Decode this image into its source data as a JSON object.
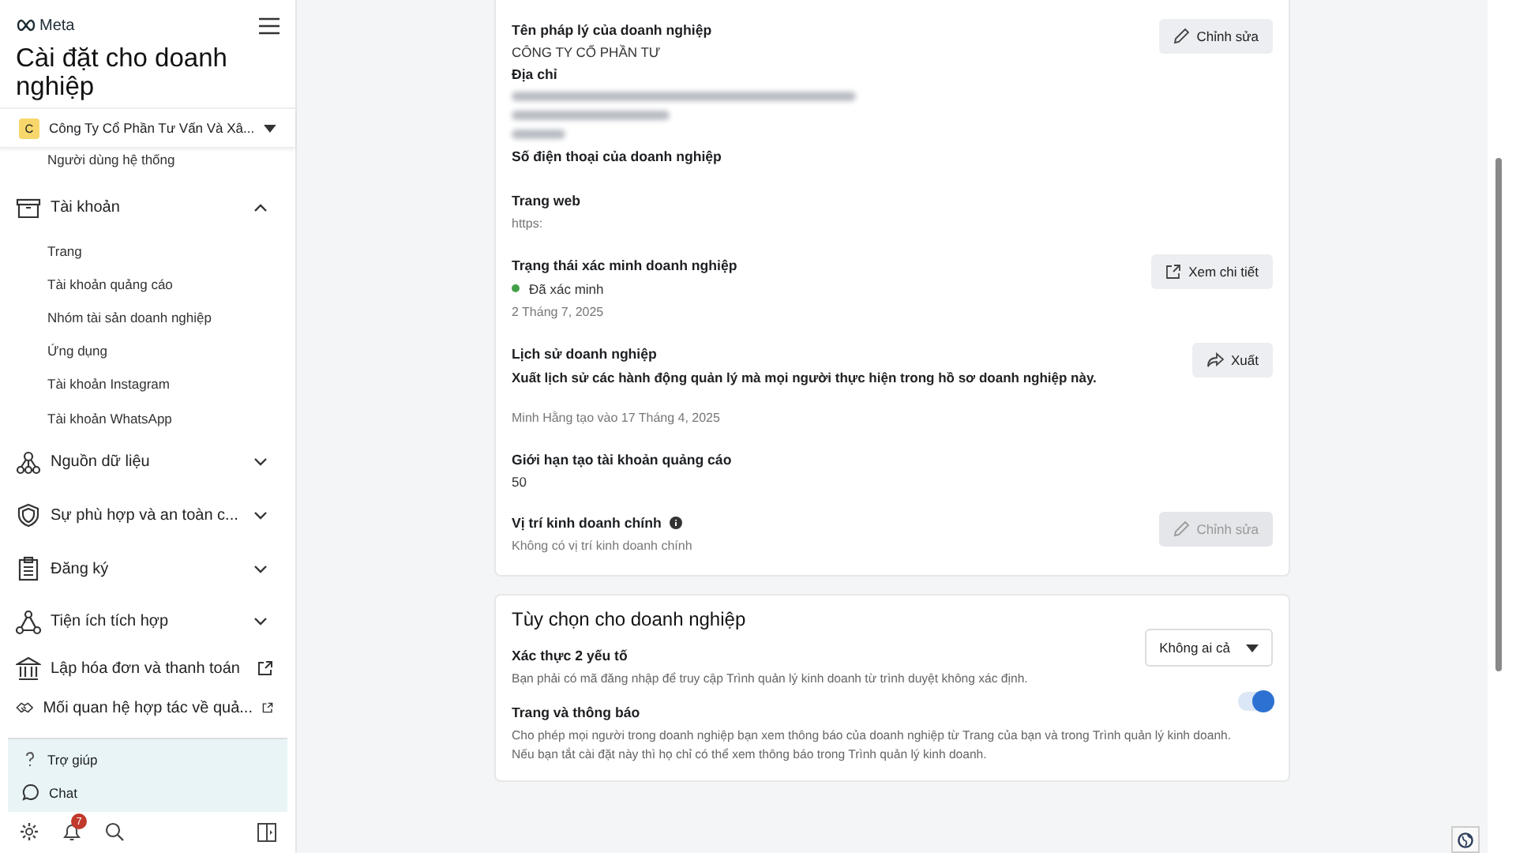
{
  "header": {
    "logo": "Meta",
    "title": "Cài đặt cho doanh nghiệp"
  },
  "business_selector": {
    "initial": "C",
    "name": "Công Ty Cổ Phần Tư Vấn Và Xâ..."
  },
  "sidebar": {
    "items": [
      {
        "kind": "item",
        "label": "Người dùng hệ thống"
      },
      {
        "kind": "group",
        "label": "Tài khoản",
        "expanded": true,
        "children": [
          {
            "label": "Trang"
          },
          {
            "label": "Tài khoản quảng cáo"
          },
          {
            "label": "Nhóm tài sản doanh nghiệp"
          },
          {
            "label": "Ứng dụng"
          },
          {
            "label": "Tài khoản Instagram"
          },
          {
            "label": "Tài khoản WhatsApp"
          }
        ]
      },
      {
        "kind": "group",
        "label": "Nguồn dữ liệu",
        "expanded": false
      },
      {
        "kind": "group",
        "label": "Sự phù hợp và an toàn c...",
        "expanded": false
      },
      {
        "kind": "group",
        "label": "Đăng ký",
        "expanded": false
      },
      {
        "kind": "group",
        "label": "Tiện ích tích hợp",
        "expanded": false
      },
      {
        "kind": "link",
        "label": "Lập hóa đơn và thanh toán"
      },
      {
        "kind": "link",
        "label": "Mối quan hệ hợp tác về quả..."
      }
    ]
  },
  "help": [
    {
      "kind": "help",
      "label": "Trợ giúp"
    },
    {
      "kind": "chat",
      "label": "Chat"
    }
  ],
  "bottom_bar": {
    "notification_count": "7"
  },
  "business_info": {
    "fields": [
      {
        "label": "Tên pháp lý của doanh nghiệp",
        "value": "CÔNG TY CỔ PHẦN TƯ",
        "button": {
          "kind": "edit",
          "label": "Chỉnh sửa",
          "disabled": false
        }
      },
      {
        "label": "Địa chỉ",
        "redacted": true
      },
      {
        "label": "Số điện thoại của doanh nghiệp"
      },
      {
        "label": "Trang web",
        "note": "https:"
      },
      {
        "label": "Trạng thái xác minh doanh nghiệp",
        "status": {
          "label": "Đã xác minh",
          "verified": true
        },
        "note": "2 Tháng 7, 2025",
        "button": {
          "kind": "view",
          "label": "Xem chi tiết",
          "disabled": false
        }
      },
      {
        "label": "Lịch sử doanh nghiệp",
        "description": "Xuất lịch sử các hành động quản lý mà mọi người thực hiện trong hồ sơ doanh nghiệp này.",
        "note": "Minh Hằng tạo vào 17 Tháng 4, 2025",
        "button": {
          "kind": "export",
          "label": "Xuất",
          "disabled": false
        }
      },
      {
        "label": "Giới hạn tạo tài khoản quảng cáo",
        "value": "50"
      },
      {
        "label": "Vị trí kinh doanh chính",
        "info": true,
        "note": "Không có vị trí kinh doanh chính",
        "button": {
          "kind": "edit",
          "label": "Chỉnh sửa",
          "disabled": true
        }
      }
    ]
  },
  "business_options": {
    "title": "Tùy chọn cho doanh nghiệp",
    "options": [
      {
        "kind": "select",
        "label": "Xác thực 2 yếu tố",
        "description": "Bạn phải có mã đăng nhập để truy cập Trình quản lý kinh doanh từ trình duyệt không xác định.",
        "value": "Không ai cả"
      },
      {
        "kind": "toggle",
        "label": "Trang và thông báo",
        "description": "Cho phép mọi người trong doanh nghiệp bạn xem thông báo của doanh nghiệp từ Trang của bạn và trong Trình quản lý kinh doanh. Nếu bạn tắt cài đặt này thì họ chỉ có thể xem thông báo trong Trình quản lý kinh doanh.",
        "on": true
      }
    ]
  }
}
